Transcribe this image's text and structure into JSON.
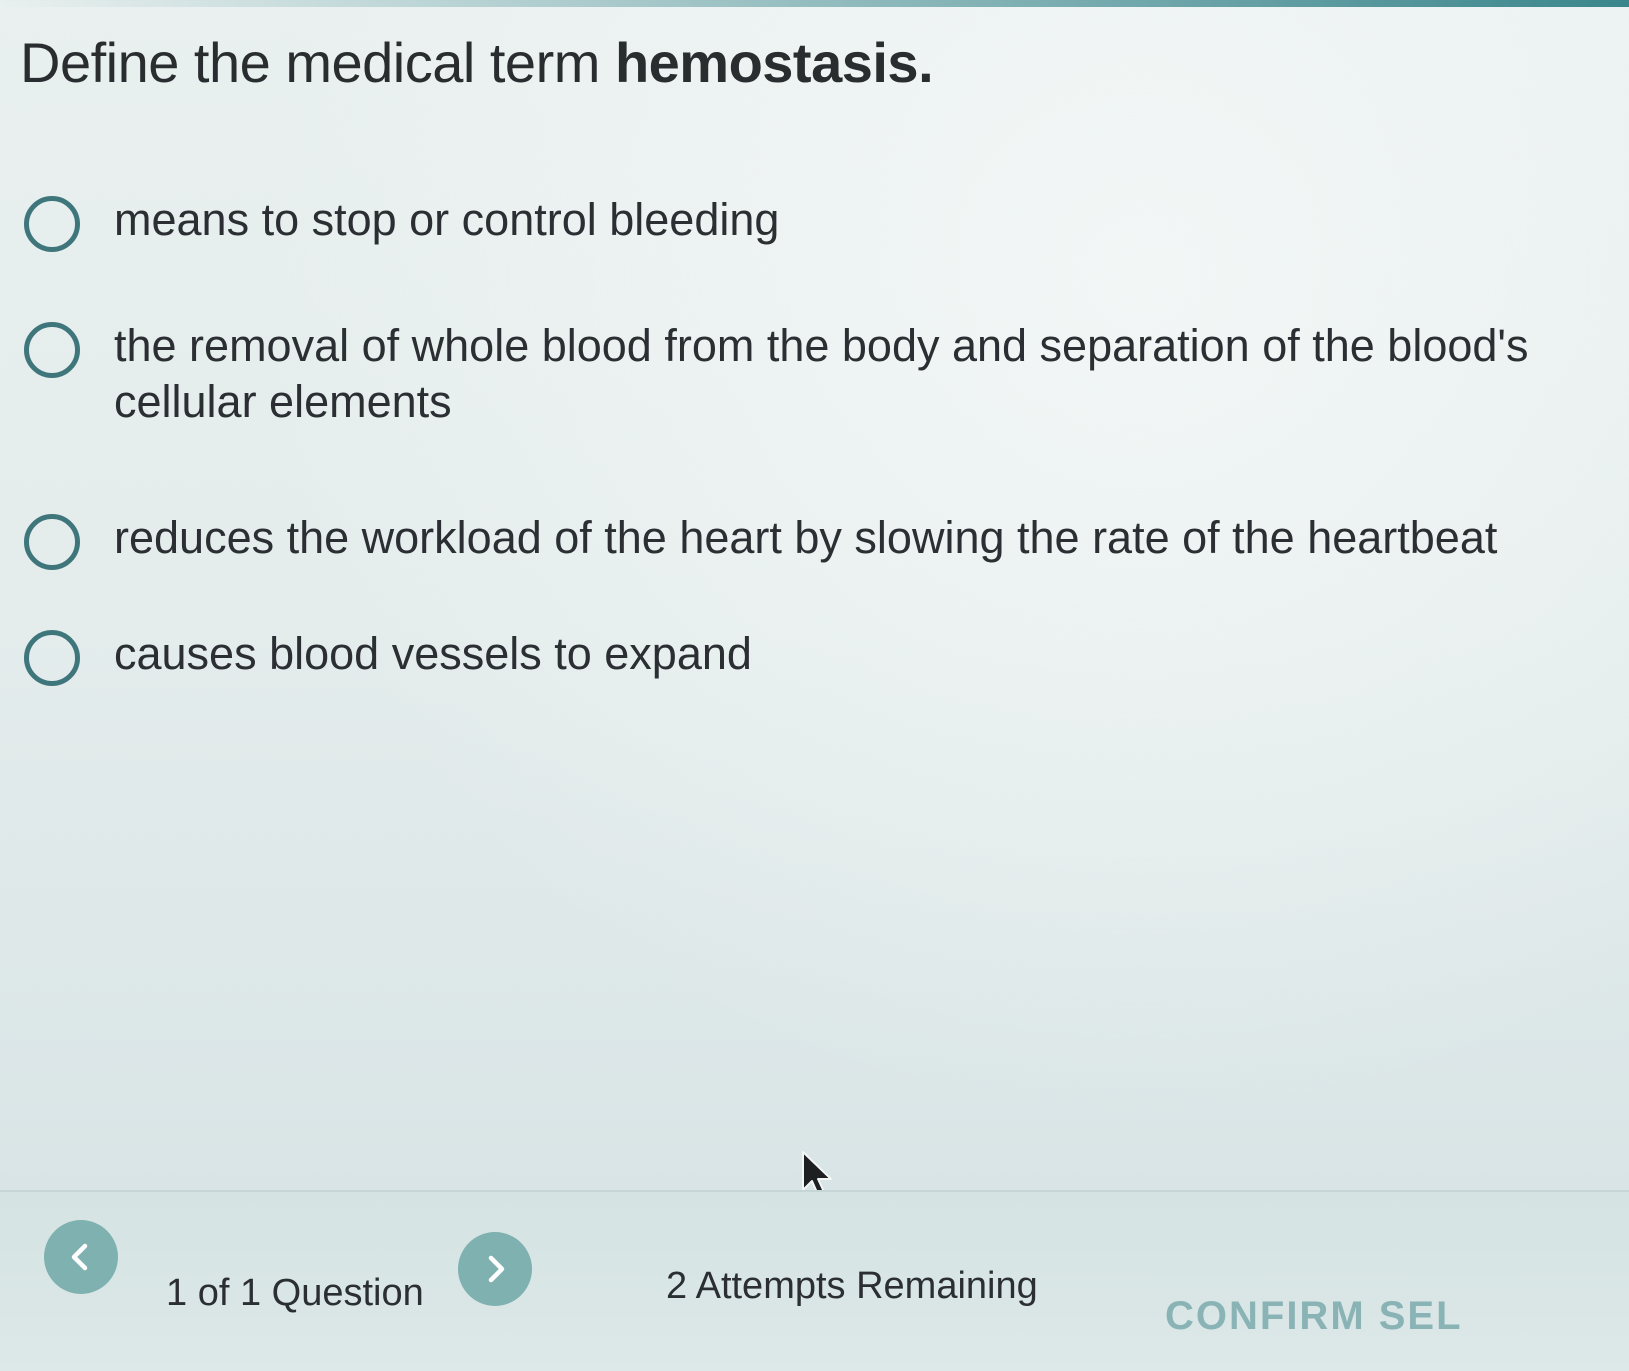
{
  "question": {
    "prefix": "Define the medical term",
    "term": "hemostasis."
  },
  "options": [
    {
      "label": "means to stop or control bleeding",
      "selected": false
    },
    {
      "label": "the removal of whole blood from the body and separation of the blood's cellular elements",
      "selected": false
    },
    {
      "label": "reduces the workload of the heart by slowing the rate of the heartbeat",
      "selected": false
    },
    {
      "label": "causes blood vessels to expand",
      "selected": false
    }
  ],
  "footer": {
    "question_count": "1 of 1 Question",
    "attempts": "2 Attempts Remaining",
    "confirm_label": "CONFIRM SEL"
  },
  "colors": {
    "accent": "#3f767c",
    "nav_button": "#7fb1b0",
    "confirm_text": "#8ab3b6"
  },
  "icons": {
    "prev": "chevron-left-icon",
    "next": "chevron-right-icon",
    "cursor": "mouse-pointer-icon",
    "radio": "radio-unchecked-icon"
  }
}
